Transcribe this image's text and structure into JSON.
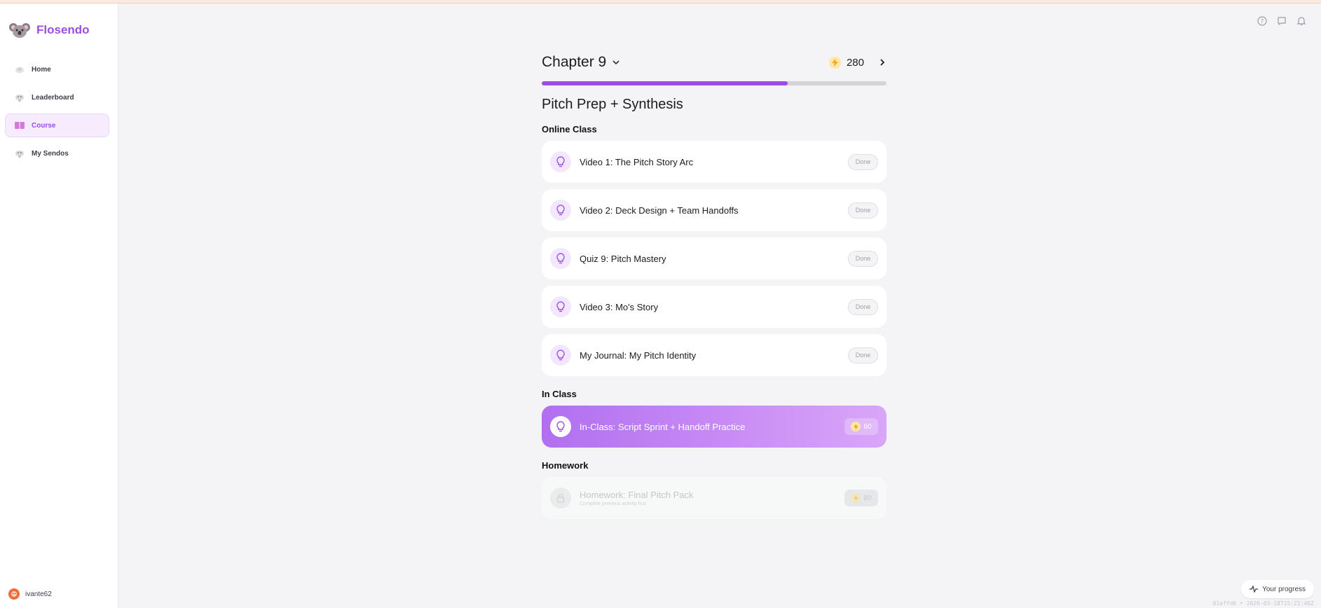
{
  "app": {
    "name": "Flosendo"
  },
  "sidebar": {
    "items": [
      {
        "label": "Home",
        "icon": "home-icon"
      },
      {
        "label": "Leaderboard",
        "icon": "trophy-icon"
      },
      {
        "label": "Course",
        "icon": "book-icon",
        "active": true
      },
      {
        "label": "My Sendos",
        "icon": "sendo-icon"
      }
    ],
    "user": {
      "name": "ivante62"
    }
  },
  "chapter": {
    "title": "Chapter 9",
    "points": "280",
    "progress_fraction": 0.714
  },
  "lesson": {
    "title": "Pitch Prep + Synthesis"
  },
  "groups": {
    "online": {
      "label": "Online Class",
      "items": [
        {
          "label": "Video 1: The Pitch Story Arc",
          "status": "Done"
        },
        {
          "label": "Video 2: Deck Design + Team Handoffs",
          "status": "Done"
        },
        {
          "label": "Quiz 9: Pitch Mastery",
          "status": "Done"
        },
        {
          "label": "Video 3: Mo's Story",
          "status": "Done"
        },
        {
          "label": "My Journal: My Pitch Identity",
          "status": "Done"
        }
      ]
    },
    "in_class": {
      "label": "In Class",
      "item": {
        "label": "In-Class: Script Sprint + Handoff Practice",
        "xp": "60"
      }
    },
    "homework": {
      "label": "Homework",
      "item": {
        "label": "Homework: Final Pitch Pack",
        "sub": "Complete previous activity first",
        "xp": "80"
      }
    }
  },
  "footer": {
    "progress_button": "Your progress",
    "build_id": "01effd6 • 2026-03-18T15:21:46Z"
  },
  "colors": {
    "accent": "#9b4de6",
    "highlight_start": "#b16ff0",
    "highlight_end": "#d9a6f8"
  }
}
